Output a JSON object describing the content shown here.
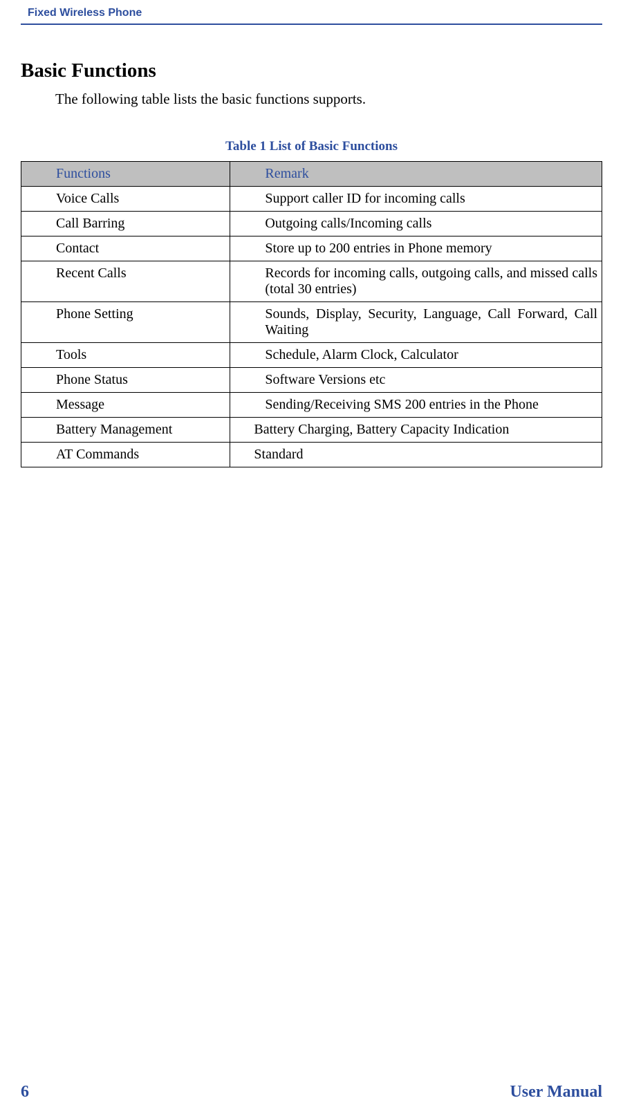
{
  "header": {
    "product": "Fixed Wireless Phone"
  },
  "section": {
    "heading": "Basic Functions",
    "intro": "The following table lists the basic functions  supports."
  },
  "table": {
    "caption": "Table 1 List of Basic Functions",
    "headers": {
      "col1": "Functions",
      "col2": "Remark"
    },
    "rows": [
      {
        "func": "Voice Calls",
        "remark": "Support caller ID for incoming calls"
      },
      {
        "func": "Call Barring",
        "remark": "Outgoing calls/Incoming calls"
      },
      {
        "func": "Contact",
        "remark": "Store up to 200 entries in Phone memory"
      },
      {
        "func": "Recent Calls",
        "remark": "Records for incoming calls, outgoing calls, and missed calls (total 30 entries)"
      },
      {
        "func": "Phone Setting",
        "remark": "Sounds, Display, Security, Language, Call Forward, Call Waiting"
      },
      {
        "func": "Tools",
        "remark": "Schedule, Alarm Clock, Calculator"
      },
      {
        "func": "Phone Status",
        "remark": "Software Versions etc"
      },
      {
        "func": "Message",
        "remark": "Sending/Receiving SMS 200 entries in the Phone"
      },
      {
        "func": "Battery Management",
        "remark": "Battery Charging, Battery Capacity Indication"
      },
      {
        "func": "AT Commands",
        "remark": "Standard"
      }
    ]
  },
  "footer": {
    "page": "6",
    "label": "User Manual"
  }
}
